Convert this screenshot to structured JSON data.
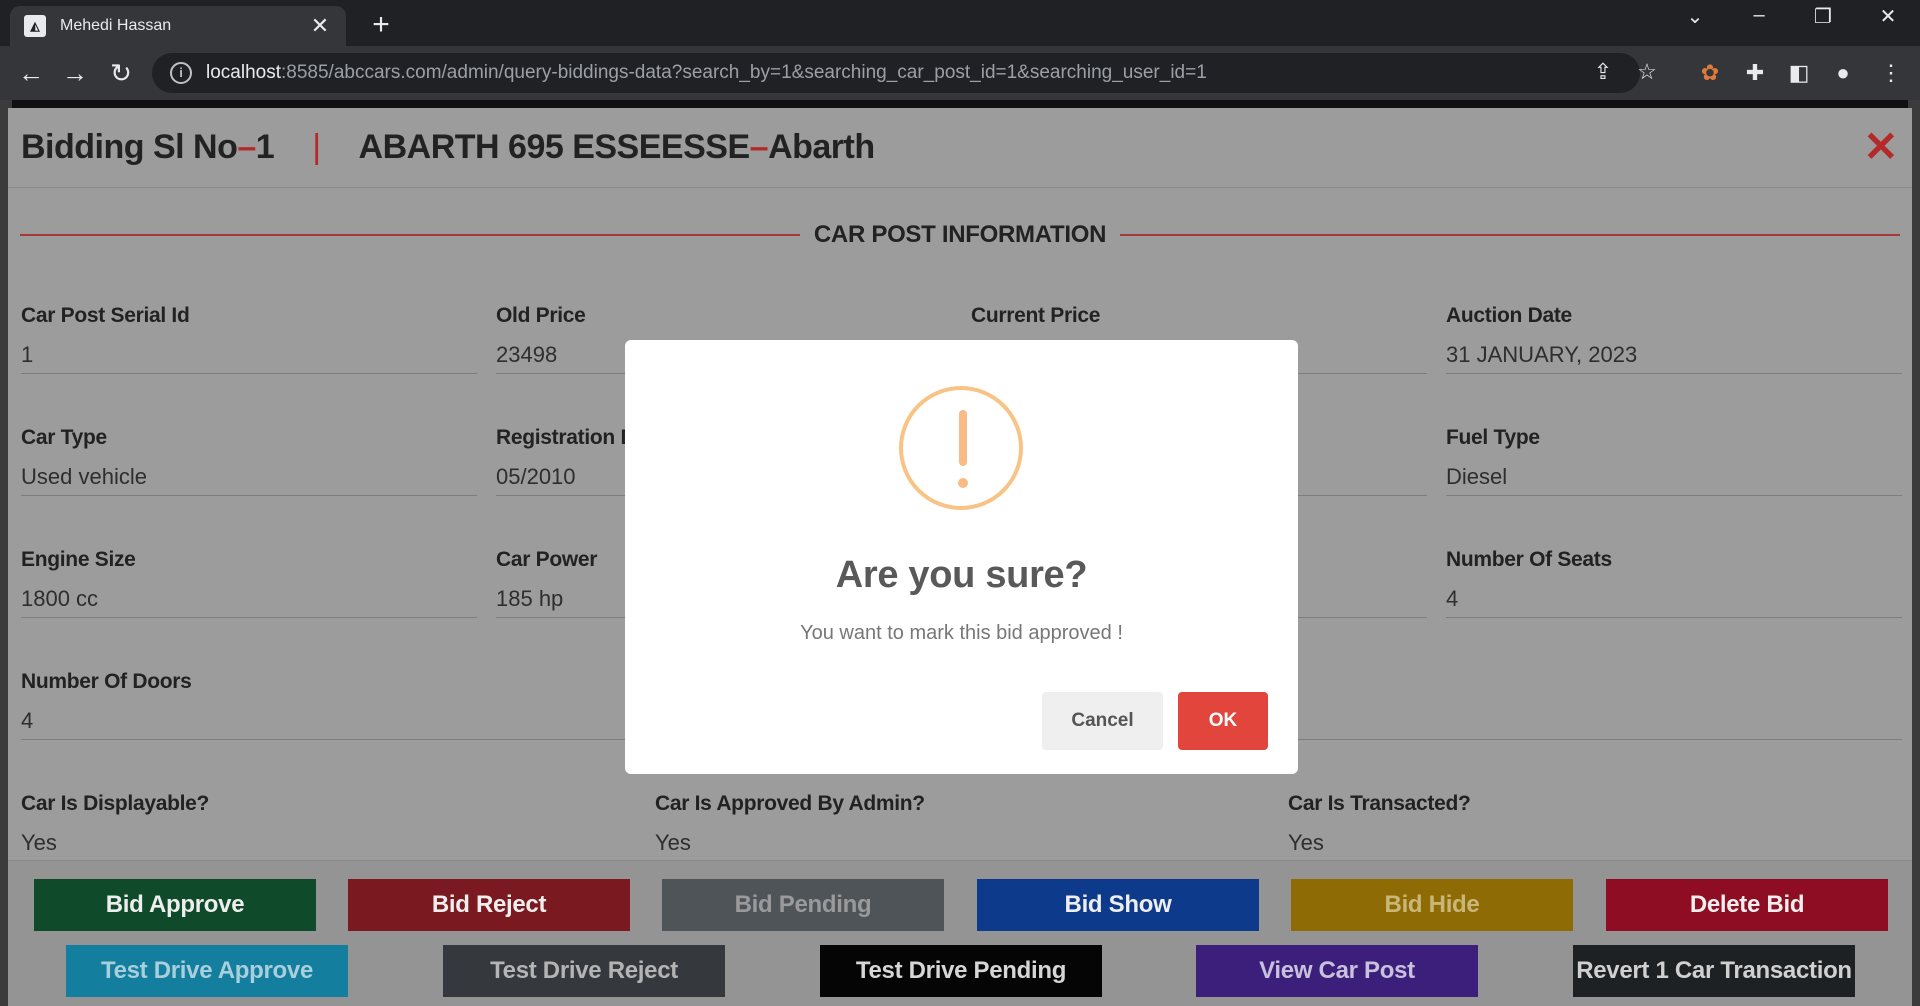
{
  "browser": {
    "tab_title": "Mehedi Hassan",
    "tab_close": "✕",
    "new_tab": "+",
    "url_host": "localhost",
    "url_rest": ":8585/abccars.com/admin/query-biddings-data?search_by=1&searching_car_post_id=1&searching_user_id=1"
  },
  "header": {
    "prefix": "Bidding Sl No",
    "dash1": " – ",
    "sl_no": "1",
    "separator": "|",
    "car_name": "ABARTH 695 ESSEESSE",
    "dash2": " – ",
    "brand": "Abarth",
    "close": "✕"
  },
  "section_title": "CAR POST INFORMATION",
  "fields": {
    "car_post_serial_id": {
      "label": "Car Post Serial Id",
      "value": "1"
    },
    "old_price": {
      "label": "Old Price",
      "value": "23498"
    },
    "current_price": {
      "label": "Current Price",
      "value": ""
    },
    "auction_date": {
      "label": "Auction Date",
      "value": "31 JANUARY, 2023"
    },
    "car_type": {
      "label": "Car Type",
      "value": "Used vehicle"
    },
    "registration_date": {
      "label": "Registration D",
      "value": "05/2010"
    },
    "fuel_type": {
      "label": "Fuel Type",
      "value": "Diesel"
    },
    "engine_size": {
      "label": "Engine Size",
      "value": "1800 cc"
    },
    "car_power": {
      "label": "Car Power",
      "value": "185 hp"
    },
    "number_of_seats": {
      "label": "Number Of Seats",
      "value": "4"
    },
    "number_of_doors": {
      "label": "Number Of Doors",
      "value": "4"
    },
    "car_is_displayable": {
      "label": "Car Is Displayable?",
      "value": "Yes"
    },
    "car_is_approved": {
      "label": "Car Is Approved By Admin?",
      "value": "Yes"
    },
    "car_is_transacted": {
      "label": "Car Is Transacted?",
      "value": "Yes"
    }
  },
  "actions": {
    "bid_approve": "Bid Approve",
    "bid_reject": "Bid Reject",
    "bid_pending": "Bid Pending",
    "bid_show": "Bid Show",
    "bid_hide": "Bid Hide",
    "delete_bid": "Delete Bid",
    "test_drive_approve": "Test Drive Approve",
    "test_drive_reject": "Test Drive Reject",
    "test_drive_pending": "Test Drive Pending",
    "view_car_post": "View Car Post",
    "revert_transaction": "Revert 1 Car Transaction"
  },
  "modal": {
    "title": "Are you sure?",
    "text": "You want to mark this bid approved !",
    "cancel": "Cancel",
    "ok": "OK"
  },
  "colors": {
    "accent_red": "#b42a2a",
    "bid_approve": "#0f4a2a",
    "bid_reject": "#7a1a20",
    "bid_pending": "#4f5458",
    "bid_show": "#0d3a8a",
    "bid_hide": "#8f6b06",
    "delete_bid": "#8e0d22",
    "test_drive_approve": "#137e9e",
    "test_drive_reject": "#35393d",
    "test_drive_pending": "#050505",
    "view_car_post": "#3b1f7a",
    "revert_transaction": "#1e2123",
    "modal_ok": "#e2453c",
    "warning": "#f8bb86"
  }
}
